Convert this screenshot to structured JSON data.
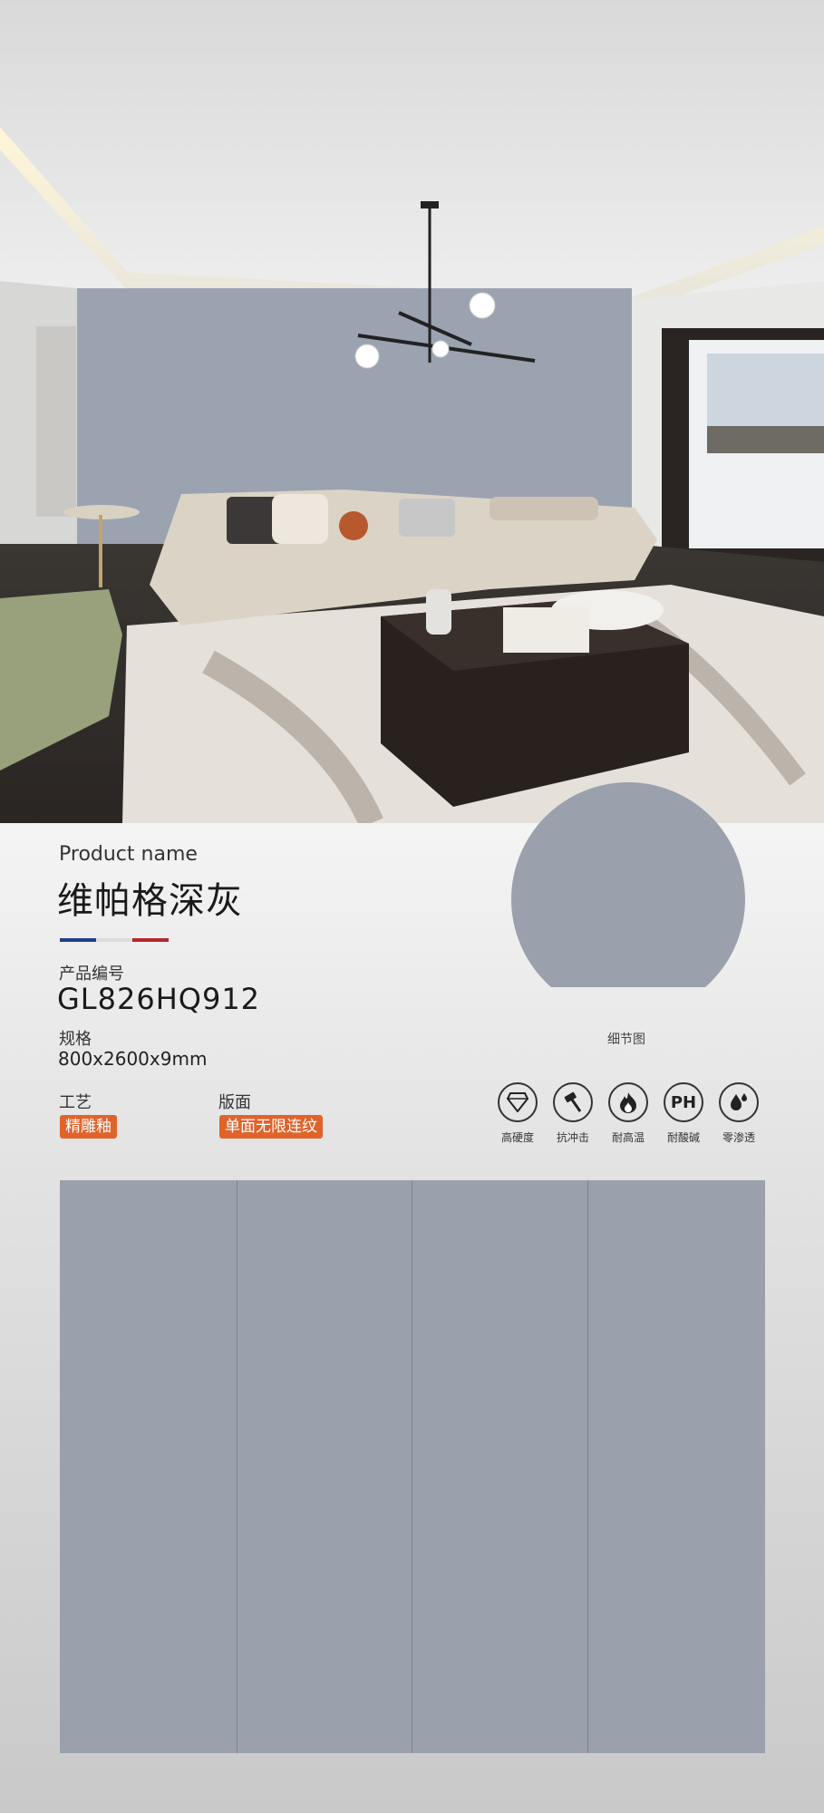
{
  "product": {
    "name_label": "Product name",
    "name": "维帕格深灰",
    "code_label": "产品编号",
    "code": "GL826HQ912",
    "spec_label": "规格",
    "spec": "800x2600x9mm",
    "craft_label": "工艺",
    "craft": "精雕釉",
    "surface_label": "版面",
    "surface": "单面无限连纹"
  },
  "flag_colors": [
    "#1f3f8c",
    "#dddddd",
    "#b5262b"
  ],
  "detail": {
    "caption": "细节图"
  },
  "features": [
    {
      "icon": "diamond-icon",
      "label": "高硬度"
    },
    {
      "icon": "hammer-icon",
      "label": "抗冲击"
    },
    {
      "icon": "flame-icon",
      "label": "耐高温"
    },
    {
      "icon": "ph-icon",
      "glyph": "PH",
      "label": "耐酸碱"
    },
    {
      "icon": "water-drop-icon",
      "label": "零渗透"
    }
  ],
  "colors": {
    "accent": "#e0632b",
    "tile": "#9aa1ad"
  }
}
